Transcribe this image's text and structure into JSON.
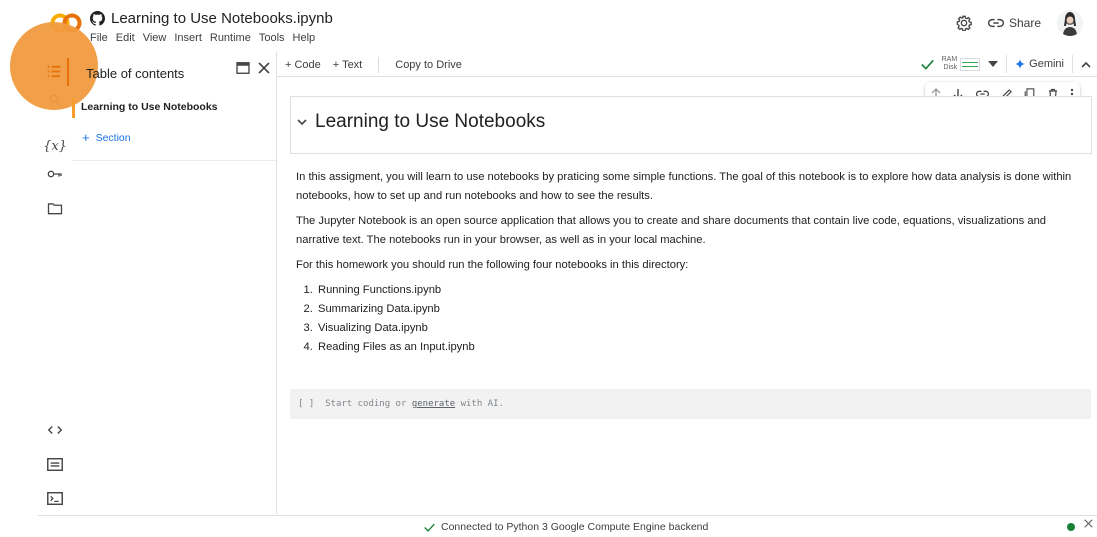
{
  "header": {
    "doc_title": "Learning to Use Notebooks.ipynb",
    "menu": [
      "File",
      "Edit",
      "View",
      "Insert",
      "Runtime",
      "Tools",
      "Help"
    ],
    "share_label": "Share"
  },
  "toc": {
    "title": "Table of contents",
    "entry": "Learning to Use Notebooks",
    "add_section": "Section"
  },
  "toolbar": {
    "code_label": "+ Code",
    "text_label": "+ Text",
    "copy_label": "Copy to Drive",
    "ram_label": "RAM",
    "disk_label": "Disk",
    "gemini_label": "Gemini"
  },
  "notebook": {
    "heading": "Learning to Use Notebooks",
    "para1": "In this assigment, you will learn to use notebooks by praticing some simple functions. The goal of this notebook is to explore how data analysis is done within notebooks, how to set up and run notebooks and how to see the results.",
    "para2": "The Jupyter Notebook is an open source application that allows you to create and share documents that contain live code, equations, visualizations and narrative text. The notebooks run in your browser, as well as in your local machine.",
    "para3": "For this homework you should run the following four notebooks in this directory:",
    "items": [
      "Running Functions.ipynb",
      "Summarizing Data.ipynb",
      "Visualizing Data.ipynb",
      "Reading Files as an Input.ipynb"
    ],
    "code_brackets": "[ ]",
    "code_prefix": "Start coding or",
    "code_link": "generate",
    "code_suffix": "with AI."
  },
  "status": {
    "text": "Connected to Python 3 Google Compute Engine backend"
  },
  "colors": {
    "accent_orange": "#f59e2d",
    "link_blue": "#1a73e8",
    "ok_green": "#188038"
  }
}
